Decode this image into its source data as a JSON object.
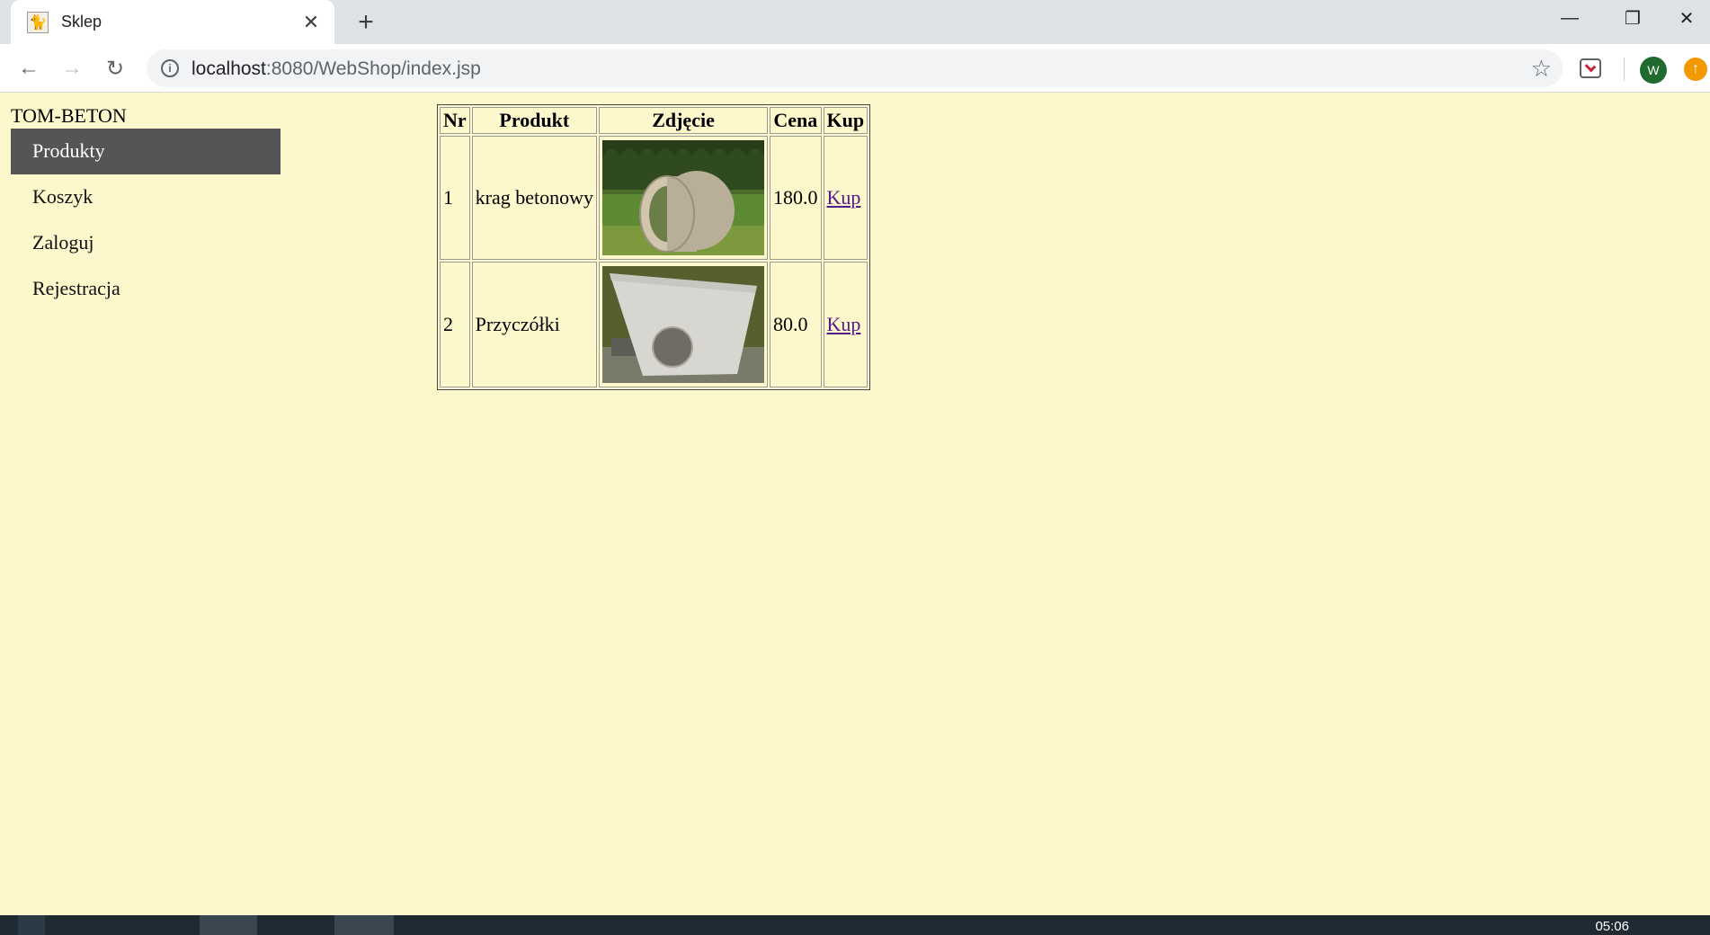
{
  "browser": {
    "tab_title": "Sklep",
    "url_host": "localhost",
    "url_rest": ":8080/WebShop/index.jsp",
    "avatar_letter": "W"
  },
  "page": {
    "brand": "TOM-BETON",
    "menu": [
      {
        "label": "Produkty",
        "active": true
      },
      {
        "label": "Koszyk",
        "active": false
      },
      {
        "label": "Zaloguj",
        "active": false
      },
      {
        "label": "Rejestracja",
        "active": false
      }
    ],
    "table": {
      "headers": [
        "Nr",
        "Produkt",
        "Zdjęcie",
        "Cena",
        "Kup"
      ],
      "rows": [
        {
          "nr": "1",
          "name": "krag betonowy",
          "photo": "concrete-ring",
          "price": "180.0",
          "buy": "Kup"
        },
        {
          "nr": "2",
          "name": "Przyczółki",
          "photo": "concrete-headwall",
          "price": "80.0",
          "buy": "Kup"
        }
      ]
    }
  },
  "taskbar": {
    "clock": "05:06"
  },
  "colors": {
    "page_bg": "#fdf7cc",
    "menu_active_bg": "#555555",
    "link": "#551a8b"
  }
}
